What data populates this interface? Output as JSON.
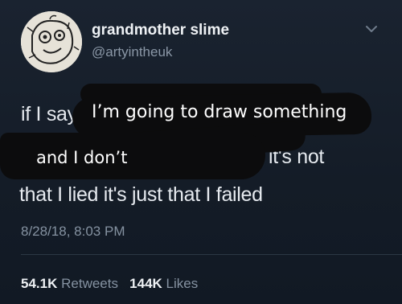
{
  "author": {
    "display_name": "grandmother slime",
    "handle": "@artyintheuk",
    "avatar_icon": "doodle-face-avatar"
  },
  "menu": {
    "icon": "chevron-down-icon"
  },
  "tweet": {
    "line1": "if I say",
    "line2": "it's not",
    "line3": "that I lied it's just that I failed"
  },
  "overlay": {
    "line1": "I’m going to draw something",
    "line2": "and I don’t"
  },
  "meta": {
    "timestamp": "8/28/18, 8:03 PM"
  },
  "stats": {
    "retweets_count": "54.1K",
    "retweets_label": "Retweets",
    "likes_count": "144K",
    "likes_label": "Likes"
  },
  "colors": {
    "background": "#141d28",
    "text_primary": "#e9edf2",
    "text_secondary": "#8592a1",
    "scribble": "#0c0c0d"
  }
}
